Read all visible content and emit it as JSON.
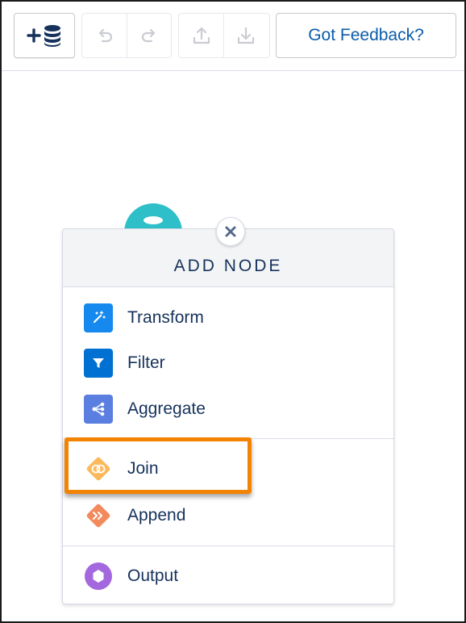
{
  "toolbar": {
    "add_data_icon": "add-database-icon",
    "feedback_label": "Got Feedback?"
  },
  "popover": {
    "title": "ADD NODE",
    "items": [
      {
        "label": "Transform",
        "icon": "transform-wand-icon",
        "color": "#1589ee"
      },
      {
        "label": "Filter",
        "icon": "filter-icon",
        "color": "#0070d2"
      },
      {
        "label": "Aggregate",
        "icon": "aggregate-icon",
        "color": "#5a7fe0"
      },
      {
        "label": "Join",
        "icon": "join-icon",
        "color": "#fcb95b"
      },
      {
        "label": "Append",
        "icon": "append-icon",
        "color": "#f38a5c"
      },
      {
        "label": "Output",
        "icon": "output-icon",
        "color": "#a468de"
      }
    ]
  },
  "colors": {
    "highlight": "#f38303",
    "source_node": "#2ebfc8",
    "text": "#16325c",
    "link": "#0b5cab"
  }
}
